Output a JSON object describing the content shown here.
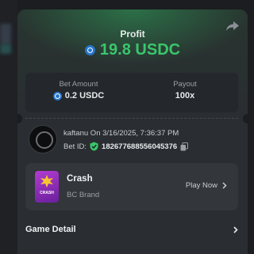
{
  "header": {
    "profit_label": "Profit",
    "profit_amount": "19.8 USDC",
    "profit_color": "#3bc66b",
    "share_icon": "share-icon"
  },
  "stats": {
    "bet_amount_label": "Bet Amount",
    "bet_amount_value": "0.2 USDC",
    "payout_label": "Payout",
    "payout_value": "100x"
  },
  "bet_info": {
    "user_line": "kaftanu On 3/16/2025, 7:36:37 PM",
    "bet_id_label": "Bet ID:",
    "bet_id": "182677688556045376"
  },
  "game": {
    "name": "Crash",
    "brand": "BC Brand",
    "thumb_text": "CRASH",
    "play_label": "Play Now"
  },
  "detail": {
    "label": "Game Detail"
  },
  "colors": {
    "accent_green": "#3bc66b",
    "usdc_blue": "#2775ca",
    "card_bg": "#2a2d31"
  }
}
